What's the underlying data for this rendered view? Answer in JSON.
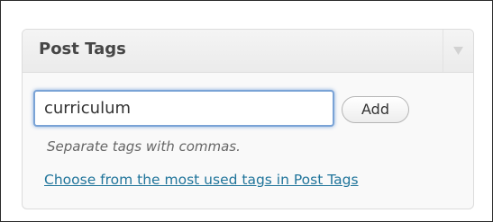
{
  "postbox": {
    "title": "Post Tags",
    "toggle_icon": "triangle-down-icon"
  },
  "tag_form": {
    "input_value": "curriculum",
    "add_label": "Add",
    "help_text": "Separate tags with commas."
  },
  "tagcloud": {
    "link_text": "Choose from the most used tags in Post Tags"
  },
  "colors": {
    "link": "#21759b",
    "title": "#464646",
    "focus_border": "#7aa3d6"
  }
}
